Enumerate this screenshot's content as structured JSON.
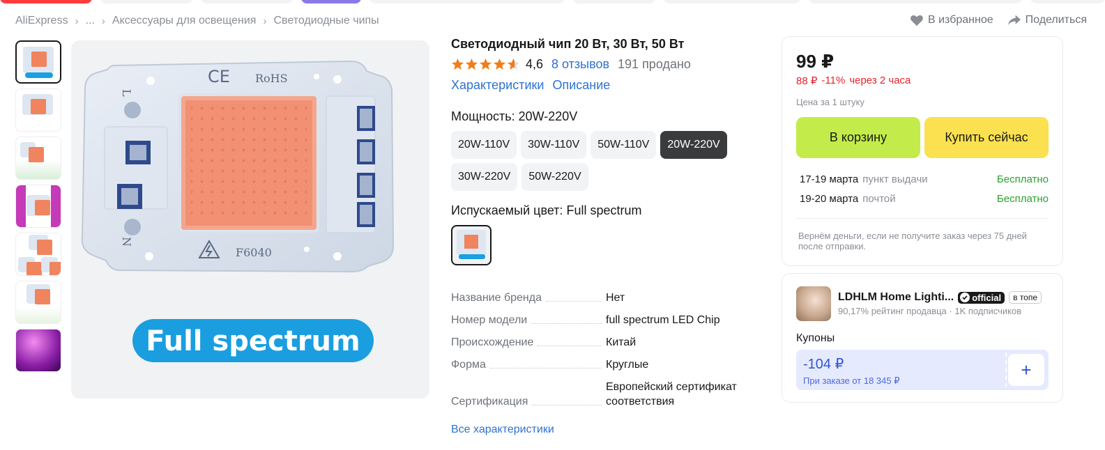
{
  "breadcrumbs": [
    "AliExpress",
    "...",
    "Аксессуары для освещения",
    "Светодиодные чипы"
  ],
  "top_actions": {
    "favorite": "В избранное",
    "share": "Поделиться"
  },
  "gallery": {
    "main_image": {
      "ce_mark": "CE",
      "rohs": "RoHS",
      "model_text": "F6040",
      "label": "Full spectrum",
      "pin_left": "L",
      "pin_right": "N"
    },
    "thumb_count": 7
  },
  "product": {
    "title": "Светодиодный чип 20 Вт, 30 Вт, 50 Вт",
    "rating": "4,6",
    "stars": 4.6,
    "reviews": "8 отзывов",
    "sold": "191 продано",
    "tabs": [
      "Характеристики",
      "Описание"
    ],
    "power_label": "Мощность: 20W-220V",
    "power_options": [
      "20W-110V",
      "30W-110V",
      "50W-110V",
      "20W-220V",
      "30W-220V",
      "50W-220V"
    ],
    "power_selected": "20W-220V",
    "color_label": "Испускаемый цвет: Full spectrum",
    "specs": [
      {
        "key": "Название бренда",
        "value": "Нет"
      },
      {
        "key": "Номер модели",
        "value": "full spectrum LED Chip"
      },
      {
        "key": "Происхождение",
        "value": "Китай"
      },
      {
        "key": "Форма",
        "value": "Круглые"
      },
      {
        "key": "Сертификация",
        "value": "Европейский сертификат соответствия"
      }
    ],
    "all_specs": "Все характеристики"
  },
  "price_card": {
    "price": "99 ₽",
    "old_price": "88 ₽",
    "discount": "-11%",
    "timer": "через 2 часа",
    "per_item": "Цена за 1 штуку",
    "cart_button": "В корзину",
    "buy_button": "Купить сейчас",
    "delivery": [
      {
        "date": "17-19 марта",
        "method": "пункт выдачи",
        "price": "Бесплатно"
      },
      {
        "date": "19-20 марта",
        "method": "почтой",
        "price": "Бесплатно"
      }
    ],
    "refund": "Вернём деньги, если не получите заказ через 75 дней после отправки."
  },
  "seller": {
    "name": "LDHLM Home Lighti...",
    "official_badge": "official",
    "top_badge": "в топе",
    "rating": "90,17% рейтинг продавца",
    "followers": "1K подписчиков",
    "coupons_label": "Купоны",
    "coupon_amount": "-104 ₽",
    "coupon_condition": "При заказе от 18 345 ₽",
    "coupon_add": "+"
  },
  "colors": {
    "link": "#2e72d2",
    "cart_button": "#c3ec4a",
    "buy_button": "#fbe14f",
    "discount": "#e5232b",
    "free_delivery": "#2aa32f",
    "star": "#f07d1a",
    "selected_option": "#3a3b3d"
  }
}
